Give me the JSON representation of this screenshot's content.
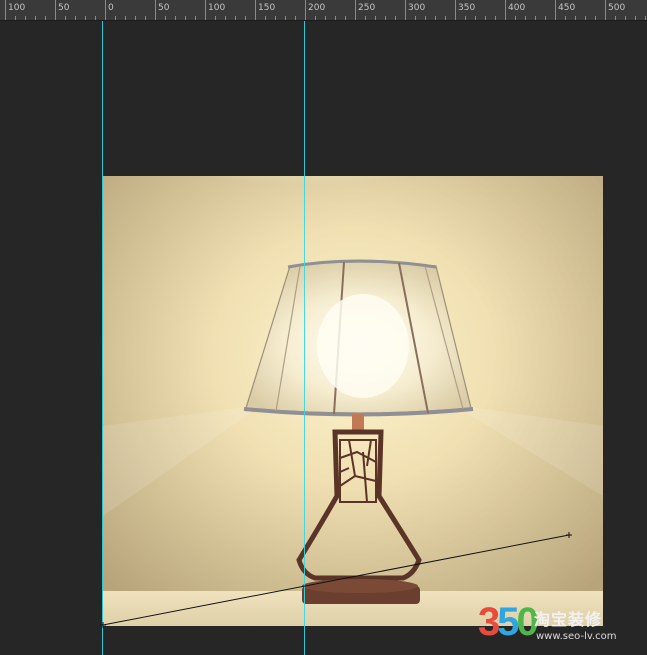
{
  "ruler": {
    "labels": [
      "100",
      "50",
      "0",
      "50",
      "100",
      "150",
      "200",
      "250",
      "300",
      "350",
      "400",
      "450",
      "500"
    ]
  },
  "watermark": {
    "digits": [
      "3",
      "5",
      "0"
    ],
    "brand": "淘宝装修",
    "url": "www.seo-lv.com"
  },
  "colors": {
    "ruler_bg": "#3a3a3a",
    "canvas_bg": "#262626",
    "guide": "#33d6e6",
    "warm_light": "#fff6d8",
    "wall": "#d8c79b",
    "lamp_base": "#6a3f30"
  }
}
